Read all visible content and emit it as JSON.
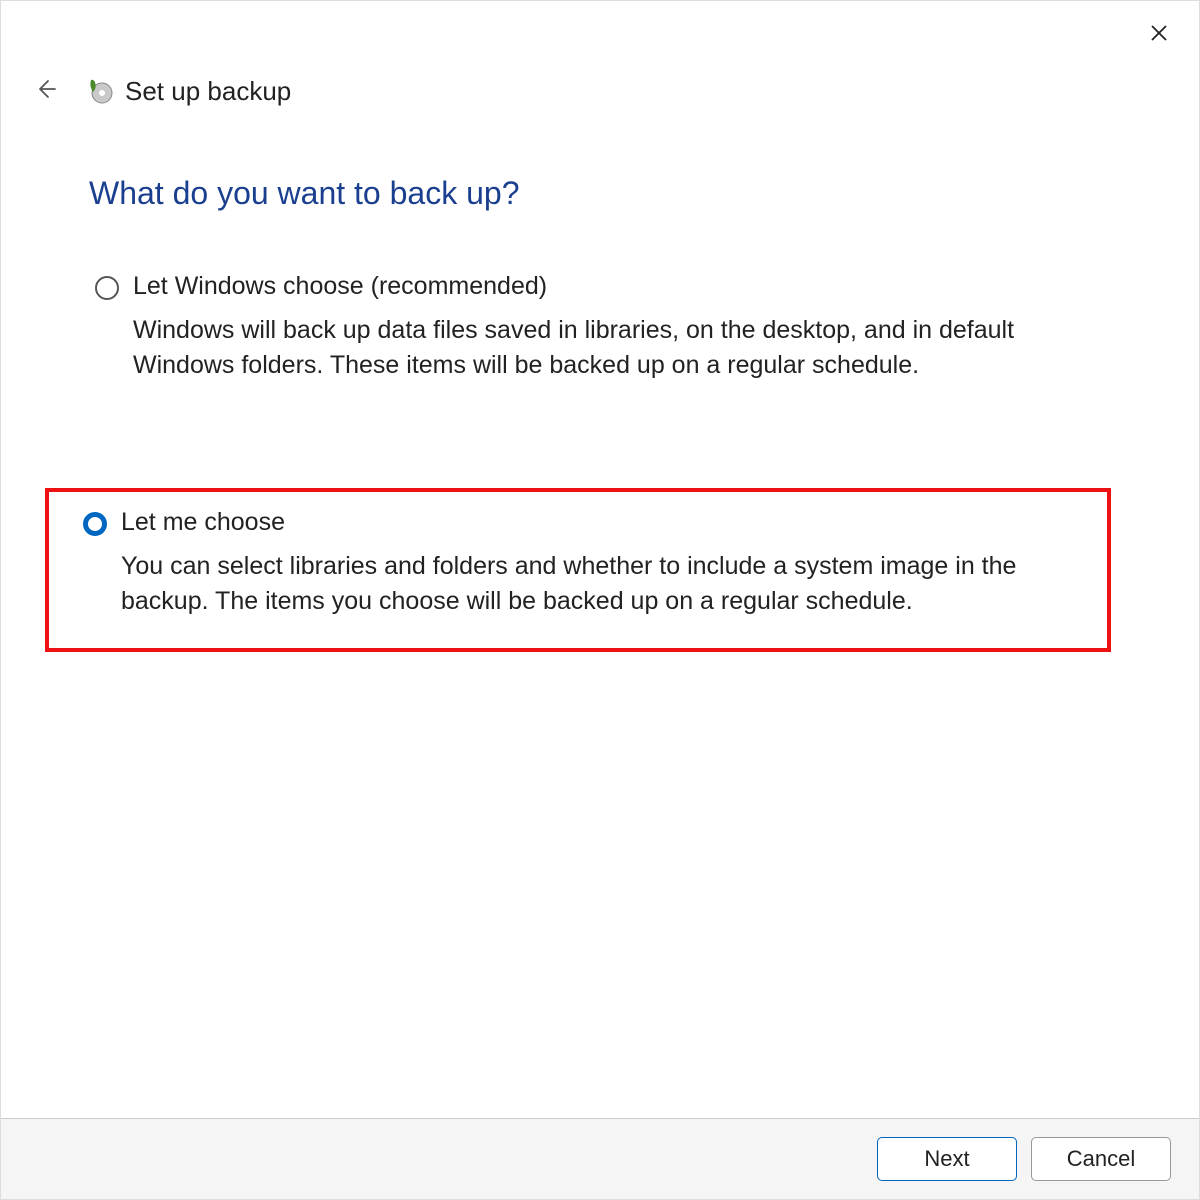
{
  "window": {
    "title": "Set up backup"
  },
  "page": {
    "heading": "What do you want to back up?"
  },
  "options": [
    {
      "label": "Let Windows choose (recommended)",
      "description": "Windows will back up data files saved in libraries, on the desktop, and in default Windows folders. These items will be backed up on a regular schedule.",
      "selected": false
    },
    {
      "label": "Let me choose",
      "description": "You can select libraries and folders and whether to include a system image in the backup. The items you choose will be backed up on a regular schedule.",
      "selected": true
    }
  ],
  "buttons": {
    "next": "Next",
    "cancel": "Cancel"
  }
}
